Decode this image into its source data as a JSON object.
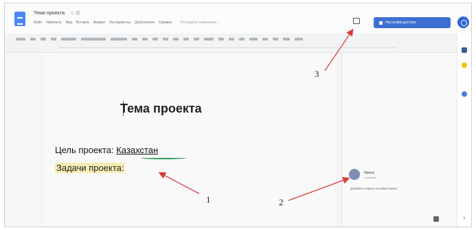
{
  "window": {
    "doc_title": "Тема проекта",
    "title_icons": "☆ ⊡",
    "menu": [
      "Файл",
      "Изменить",
      "Вид",
      "Вставка",
      "Формат",
      "Инструменты",
      "Дополнения",
      "Справка"
    ],
    "menu_last": "Последнее изменение..."
  },
  "share_button": {
    "label": "Настройки доступа"
  },
  "document": {
    "heading": "Тема проекта",
    "line1_prefix": "Цель проекта: ",
    "line1_link": "Казахстан",
    "line2": "Задачи проекта:"
  },
  "comment": {
    "name": "Ирина",
    "time": "2 минуты",
    "reply": "Добавить задачу в комментарии"
  },
  "annotations": [
    "1",
    "2",
    "3"
  ],
  "colors": {
    "share": "#3d6fd1",
    "highlight": "#f5edb3",
    "arrow": "#d93a3a",
    "spell_underline": "#2e9d5f"
  },
  "icons": [
    "docs-icon",
    "comment-history-icon",
    "account-avatar-icon",
    "keep-icon",
    "tasks-icon",
    "explore-icon",
    "add-comment-icon"
  ]
}
